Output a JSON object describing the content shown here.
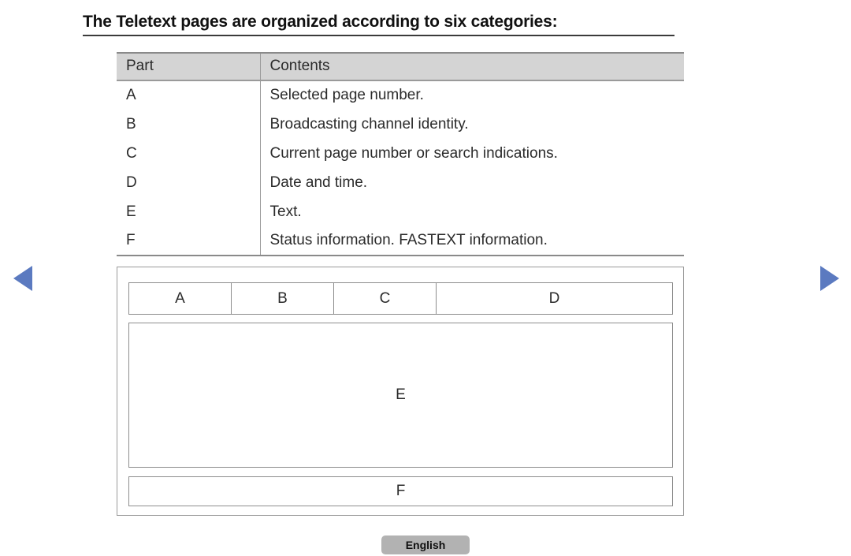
{
  "heading": {
    "text": "The Teletext pages are organized according to six categories:"
  },
  "table": {
    "columns": [
      "Part",
      "Contents"
    ],
    "rows": [
      {
        "part": "A",
        "contents": "Selected page number."
      },
      {
        "part": "B",
        "contents": "Broadcasting channel identity."
      },
      {
        "part": "C",
        "contents": "Current page number or search indications."
      },
      {
        "part": "D",
        "contents": "Date and time."
      },
      {
        "part": "E",
        "contents": "Text."
      },
      {
        "part": "F",
        "contents": "Status information. FASTEXT information."
      }
    ]
  },
  "diagram": {
    "top_strip": [
      "A",
      "B",
      "C",
      "D"
    ],
    "body_label": "E",
    "status_label": "F"
  },
  "navigation": {
    "prev_label": "prev-page-arrow",
    "next_label": "next-page-arrow"
  },
  "footer": {
    "language_button": "English"
  },
  "colors": {
    "arrow": "#5b7ac0",
    "header_fill": "#d4d4d4",
    "button_fill": "#b2b2b2",
    "rule": "#3b3b3b"
  }
}
